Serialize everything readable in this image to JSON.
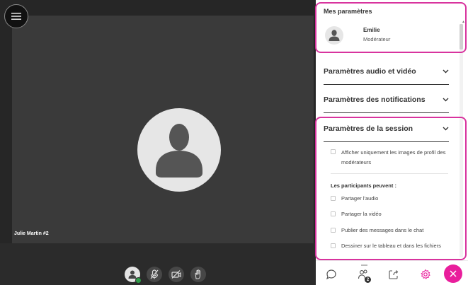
{
  "stage": {
    "participant_name": "Julie Martin #2"
  },
  "controls": {
    "items": [
      {
        "icon": "avatar-icon",
        "status_color": "#2e9b47"
      },
      {
        "icon": "microphone-off-icon"
      },
      {
        "icon": "camera-off-icon"
      },
      {
        "icon": "raise-hand-icon"
      }
    ]
  },
  "panel": {
    "title": "Mes paramètres",
    "me": {
      "name": "Emilie",
      "role": "Modérateur"
    },
    "sections": {
      "audio_video": "Paramètres audio et vidéo",
      "notifications": "Paramètres des notifications",
      "session": "Paramètres de la session"
    },
    "session": {
      "moderator_images_only": "Afficher uniquement les images de profil des modérateurs",
      "participants_can": "Les participants peuvent :",
      "options": [
        "Partager l'audio",
        "Partager la vidéo",
        "Publier des messages dans le chat",
        "Dessiner sur le tableau et dans les fichiers"
      ]
    }
  },
  "tabbar": {
    "attendees_badge": "2",
    "accent": "#e91e9c"
  },
  "highlight_color": "#d8339e"
}
